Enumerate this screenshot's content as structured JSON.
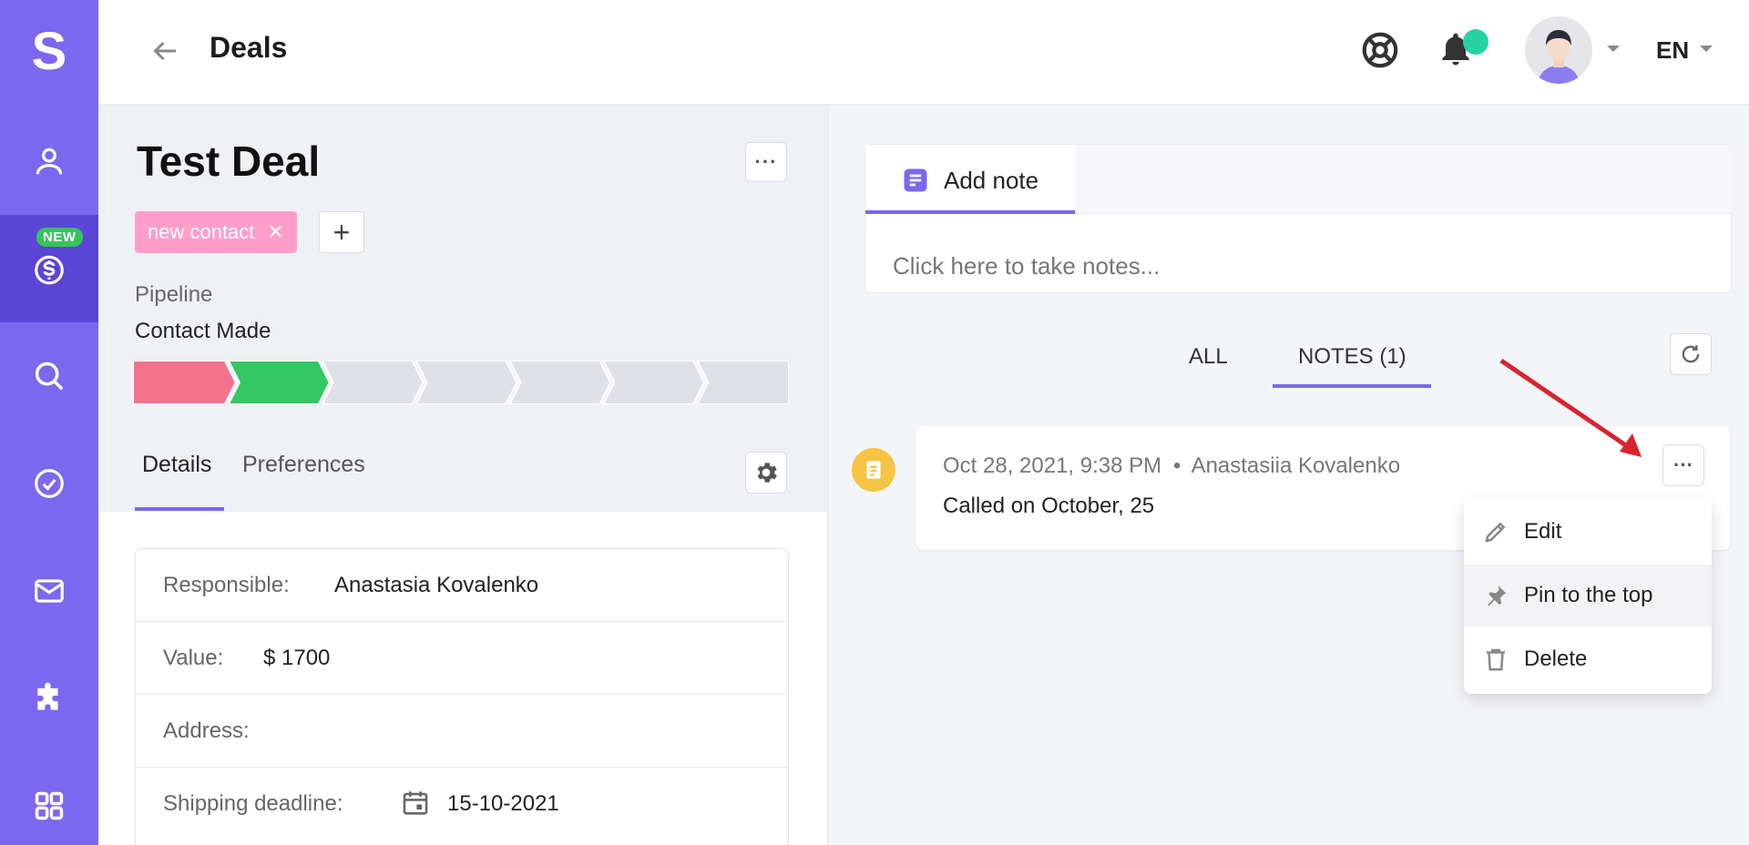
{
  "sidebar": {
    "logo": "S",
    "new_badge": "NEW",
    "items": [
      {
        "icon": "user-icon"
      },
      {
        "icon": "dollar-icon"
      },
      {
        "icon": "search-icon"
      },
      {
        "icon": "check-circle-icon"
      },
      {
        "icon": "mail-icon"
      },
      {
        "icon": "puzzle-icon"
      },
      {
        "icon": "grid-icon"
      }
    ],
    "accent": "#7b68ee"
  },
  "header": {
    "title": "Deals",
    "language": "EN",
    "notification_dot_color": "#26d3a0"
  },
  "deal": {
    "title": "Test Deal",
    "tag": "new contact",
    "pipeline_label": "Pipeline",
    "pipeline_stage": "Contact Made",
    "pipeline_stages_total": 7,
    "pipeline_stage_colors": [
      "#f5728f",
      "#33c862",
      "#dfe1e6",
      "#dfe1e6",
      "#dfe1e6",
      "#dfe1e6",
      "#dfe1e6"
    ],
    "tabs": [
      "Details",
      "Preferences"
    ],
    "details": [
      {
        "label": "Responsible:",
        "value": "Anastasia Kovalenko"
      },
      {
        "label": "Value:",
        "value": "$ 1700"
      },
      {
        "label": "Address:",
        "value": ""
      },
      {
        "label": "Shipping deadline:",
        "value": "15-10-2021"
      }
    ]
  },
  "notes": {
    "add_note_label": "Add note",
    "placeholder": "Click here to take notes...",
    "feed_tabs": [
      "ALL",
      "NOTES (1)"
    ],
    "entry": {
      "date": "Oct 28, 2021, 9:38 PM",
      "separator": "•",
      "author": "Anastasiia Kovalenko",
      "text": "Called on October, 25"
    },
    "menu": [
      "Edit",
      "Pin to the top",
      "Delete"
    ]
  }
}
